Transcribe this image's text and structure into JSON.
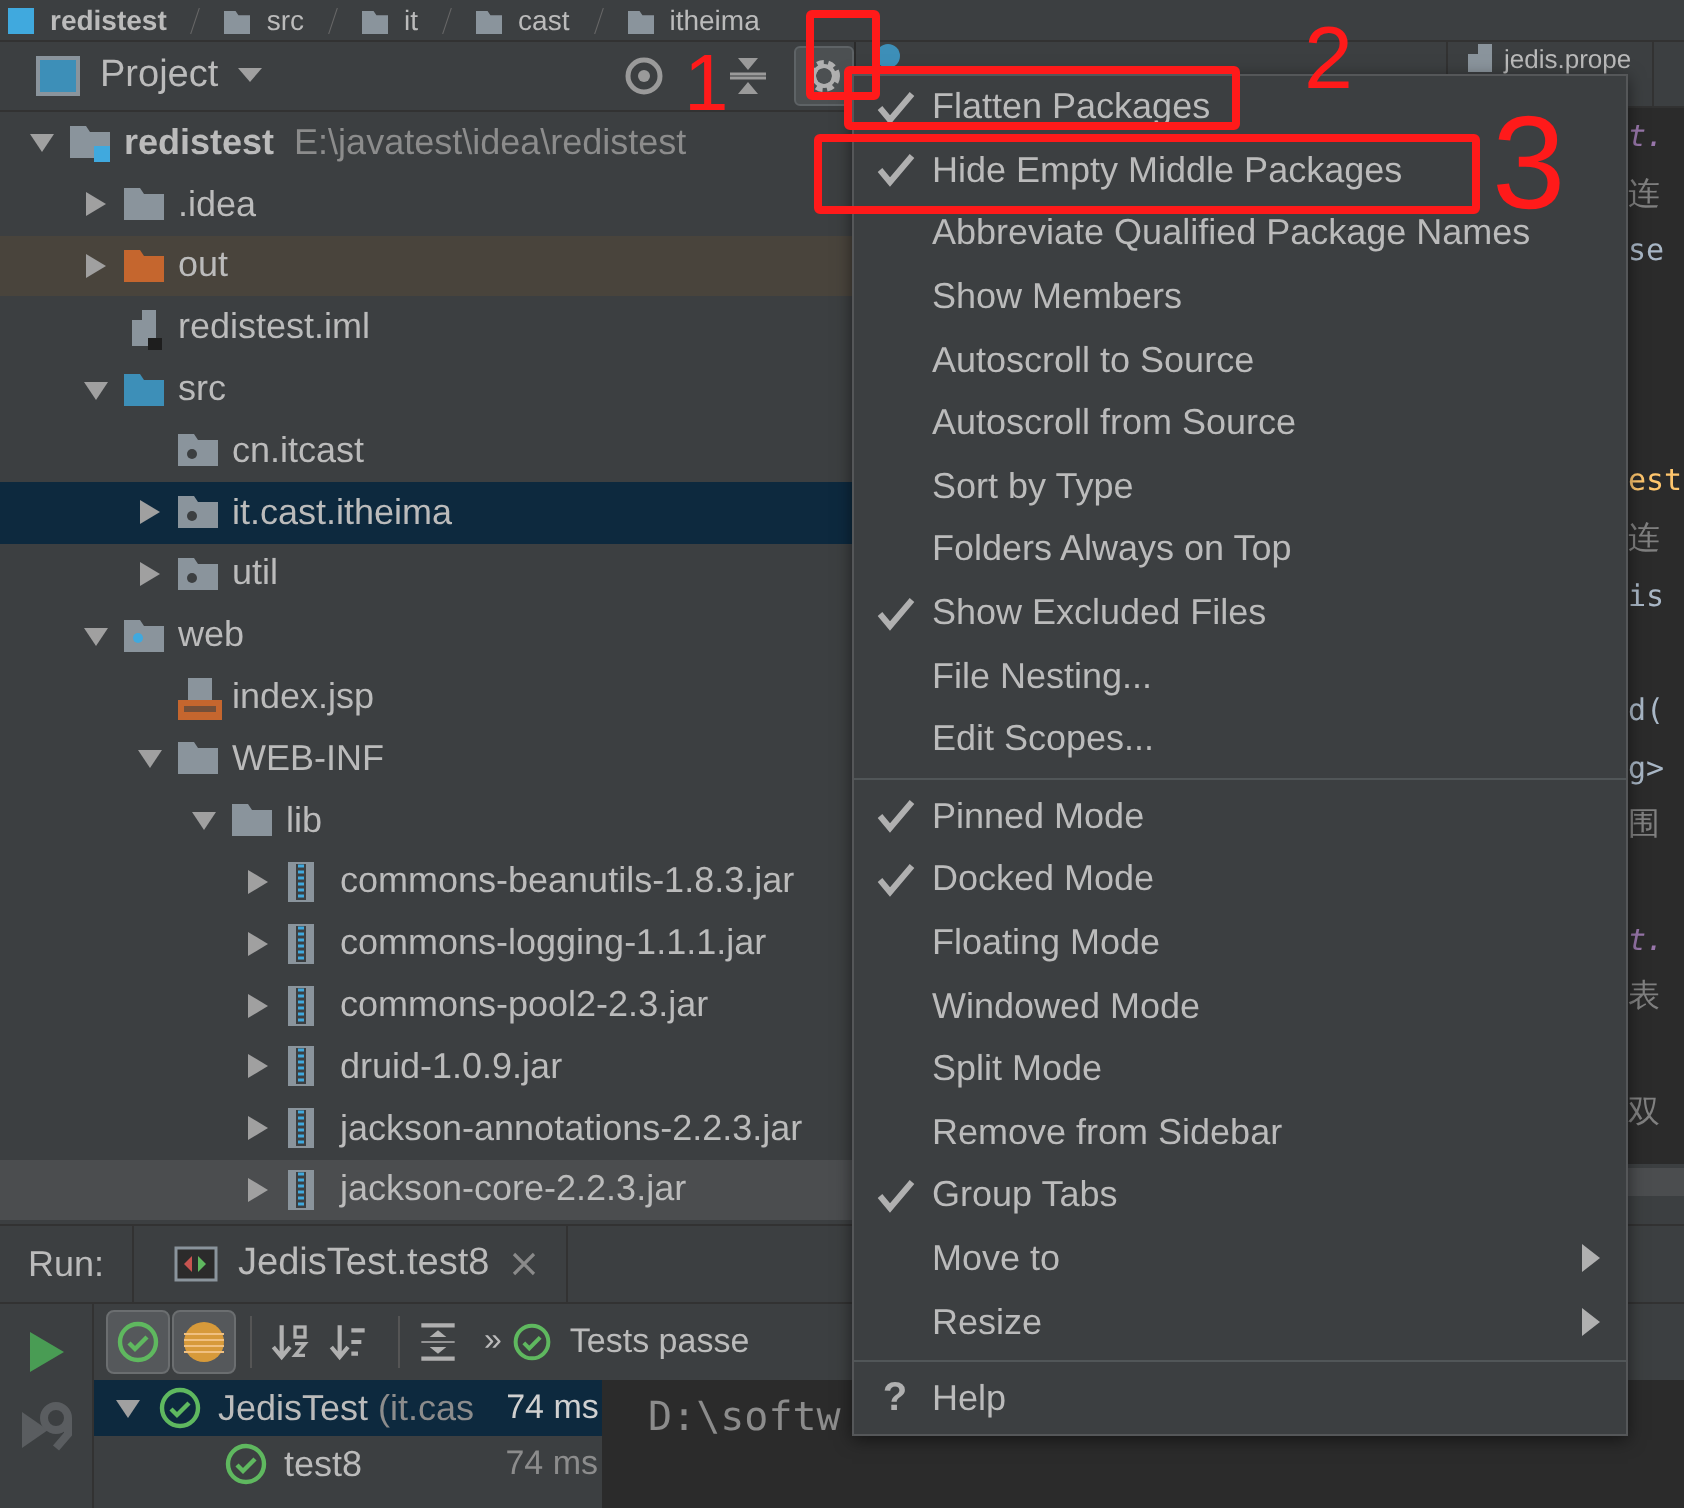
{
  "breadcrumbs": [
    "redistest",
    "src",
    "it",
    "cast",
    "itheima"
  ],
  "project_panel": {
    "title": "Project",
    "tree": [
      {
        "kind": "module",
        "name": "redistest",
        "path": "E:\\javatest\\idea\\redistest",
        "expanded": true,
        "selected": false,
        "hovered": false,
        "children": [
          {
            "kind": "folder",
            "name": ".idea",
            "expanded": false,
            "selected": false,
            "hovered": false
          },
          {
            "kind": "excluded",
            "name": "out",
            "expanded": false,
            "selected": false,
            "hovered": false
          },
          {
            "kind": "iml",
            "name": "redistest.iml",
            "selected": false,
            "hovered": false
          },
          {
            "kind": "source",
            "name": "src",
            "expanded": true,
            "selected": false,
            "hovered": false,
            "children": [
              {
                "kind": "package",
                "name": "cn.itcast",
                "selected": false,
                "hovered": false
              },
              {
                "kind": "package",
                "name": "it.cast.itheima",
                "expanded": false,
                "selected": true,
                "hovered": false
              },
              {
                "kind": "package",
                "name": "util",
                "expanded": false,
                "selected": false,
                "hovered": false
              }
            ]
          },
          {
            "kind": "web",
            "name": "web",
            "expanded": true,
            "selected": false,
            "hovered": false,
            "children": [
              {
                "kind": "jsp",
                "name": "index.jsp",
                "selected": false,
                "hovered": false
              },
              {
                "kind": "folder",
                "name": "WEB-INF",
                "expanded": true,
                "selected": false,
                "hovered": false,
                "children": [
                  {
                    "kind": "folder",
                    "name": "lib",
                    "expanded": true,
                    "selected": false,
                    "hovered": false,
                    "children": [
                      {
                        "kind": "jar",
                        "name": "commons-beanutils-1.8.3.jar",
                        "expanded": false,
                        "selected": false,
                        "hovered": false
                      },
                      {
                        "kind": "jar",
                        "name": "commons-logging-1.1.1.jar",
                        "expanded": false,
                        "selected": false,
                        "hovered": false
                      },
                      {
                        "kind": "jar",
                        "name": "commons-pool2-2.3.jar",
                        "expanded": false,
                        "selected": false,
                        "hovered": false
                      },
                      {
                        "kind": "jar",
                        "name": "druid-1.0.9.jar",
                        "expanded": false,
                        "selected": false,
                        "hovered": false
                      },
                      {
                        "kind": "jar",
                        "name": "jackson-annotations-2.2.3.jar",
                        "expanded": false,
                        "selected": false,
                        "hovered": false
                      },
                      {
                        "kind": "jar",
                        "name": "jackson-core-2.2.3.jar",
                        "expanded": false,
                        "selected": false,
                        "hovered": true
                      }
                    ]
                  }
                ]
              }
            ]
          }
        ]
      }
    ]
  },
  "editor": {
    "tabs": [
      {
        "kind": "java"
      },
      {
        "kind": "properties",
        "label": "jedis.prope"
      }
    ],
    "lines": [
      {
        "kind": "static",
        "text": "t."
      },
      {
        "kind": "comment",
        "text": "连"
      },
      {
        "kind": "code",
        "text": "se"
      },
      {
        "kind": "blank"
      },
      {
        "kind": "blank"
      },
      {
        "kind": "blank"
      },
      {
        "kind": "field",
        "text": "est"
      },
      {
        "kind": "comment",
        "text": "连"
      },
      {
        "kind": "code",
        "text": "is"
      },
      {
        "kind": "blank"
      },
      {
        "kind": "code",
        "text": "d("
      },
      {
        "kind": "code",
        "text": "g>"
      },
      {
        "kind": "comment",
        "text": "围"
      },
      {
        "kind": "blank"
      },
      {
        "kind": "static",
        "text": "t."
      },
      {
        "kind": "comment",
        "text": "表"
      },
      {
        "kind": "blank"
      },
      {
        "kind": "comment",
        "text": "双"
      }
    ]
  },
  "view_options_menu": {
    "items": [
      {
        "kind": "option",
        "label": "Flatten Packages",
        "checked": true
      },
      {
        "kind": "option",
        "label": "Hide Empty Middle Packages",
        "checked": true
      },
      {
        "kind": "option",
        "label": "Abbreviate Qualified Package Names",
        "checked": false
      },
      {
        "kind": "option",
        "label": "Show Members",
        "checked": false
      },
      {
        "kind": "option",
        "label": "Autoscroll to Source",
        "checked": false
      },
      {
        "kind": "option",
        "label": "Autoscroll from Source",
        "checked": false
      },
      {
        "kind": "option",
        "label": "Sort by Type",
        "checked": false
      },
      {
        "kind": "option",
        "label": "Folders Always on Top",
        "checked": false
      },
      {
        "kind": "option",
        "label": "Show Excluded Files",
        "checked": true
      },
      {
        "kind": "option",
        "label": "File Nesting...",
        "checked": false
      },
      {
        "kind": "option",
        "label": "Edit Scopes...",
        "checked": false
      },
      {
        "kind": "separator"
      },
      {
        "kind": "option",
        "label": "Pinned Mode",
        "checked": true
      },
      {
        "kind": "option",
        "label": "Docked Mode",
        "checked": true
      },
      {
        "kind": "option",
        "label": "Floating Mode",
        "checked": false
      },
      {
        "kind": "option",
        "label": "Windowed Mode",
        "checked": false
      },
      {
        "kind": "option",
        "label": "Split Mode",
        "checked": false
      },
      {
        "kind": "option",
        "label": "Remove from Sidebar",
        "checked": false
      },
      {
        "kind": "option",
        "label": "Group Tabs",
        "checked": true
      },
      {
        "kind": "submenu",
        "label": "Move to"
      },
      {
        "kind": "submenu",
        "label": "Resize"
      },
      {
        "kind": "separator"
      },
      {
        "kind": "help",
        "icon_text": "?",
        "label": "Help"
      }
    ]
  },
  "run_panel": {
    "label": "Run:",
    "tab": {
      "label": "JedisTest.test8"
    },
    "toggles": [
      {
        "kind": "passed",
        "on": true
      },
      {
        "kind": "ignored",
        "on": true
      }
    ],
    "actions": [
      {
        "kind": "sort-alpha"
      },
      {
        "kind": "sort-duration"
      },
      {
        "kind": "expand"
      }
    ],
    "more": "»",
    "status": "Tests passe",
    "tests": [
      {
        "name": "JedisTest",
        "package": "(it.cas",
        "time": "74 ms",
        "expanded": true,
        "selected": true,
        "children": [
          {
            "name": "test8",
            "time": "74 ms",
            "selected": false
          }
        ]
      }
    ],
    "console": "D:\\softw"
  },
  "annotations": [
    {
      "kind": "frame"
    },
    {
      "kind": "number",
      "text": "1"
    },
    {
      "kind": "number",
      "text": "2"
    },
    {
      "kind": "frame"
    },
    {
      "kind": "frame"
    },
    {
      "kind": "number",
      "text": "3"
    }
  ]
}
